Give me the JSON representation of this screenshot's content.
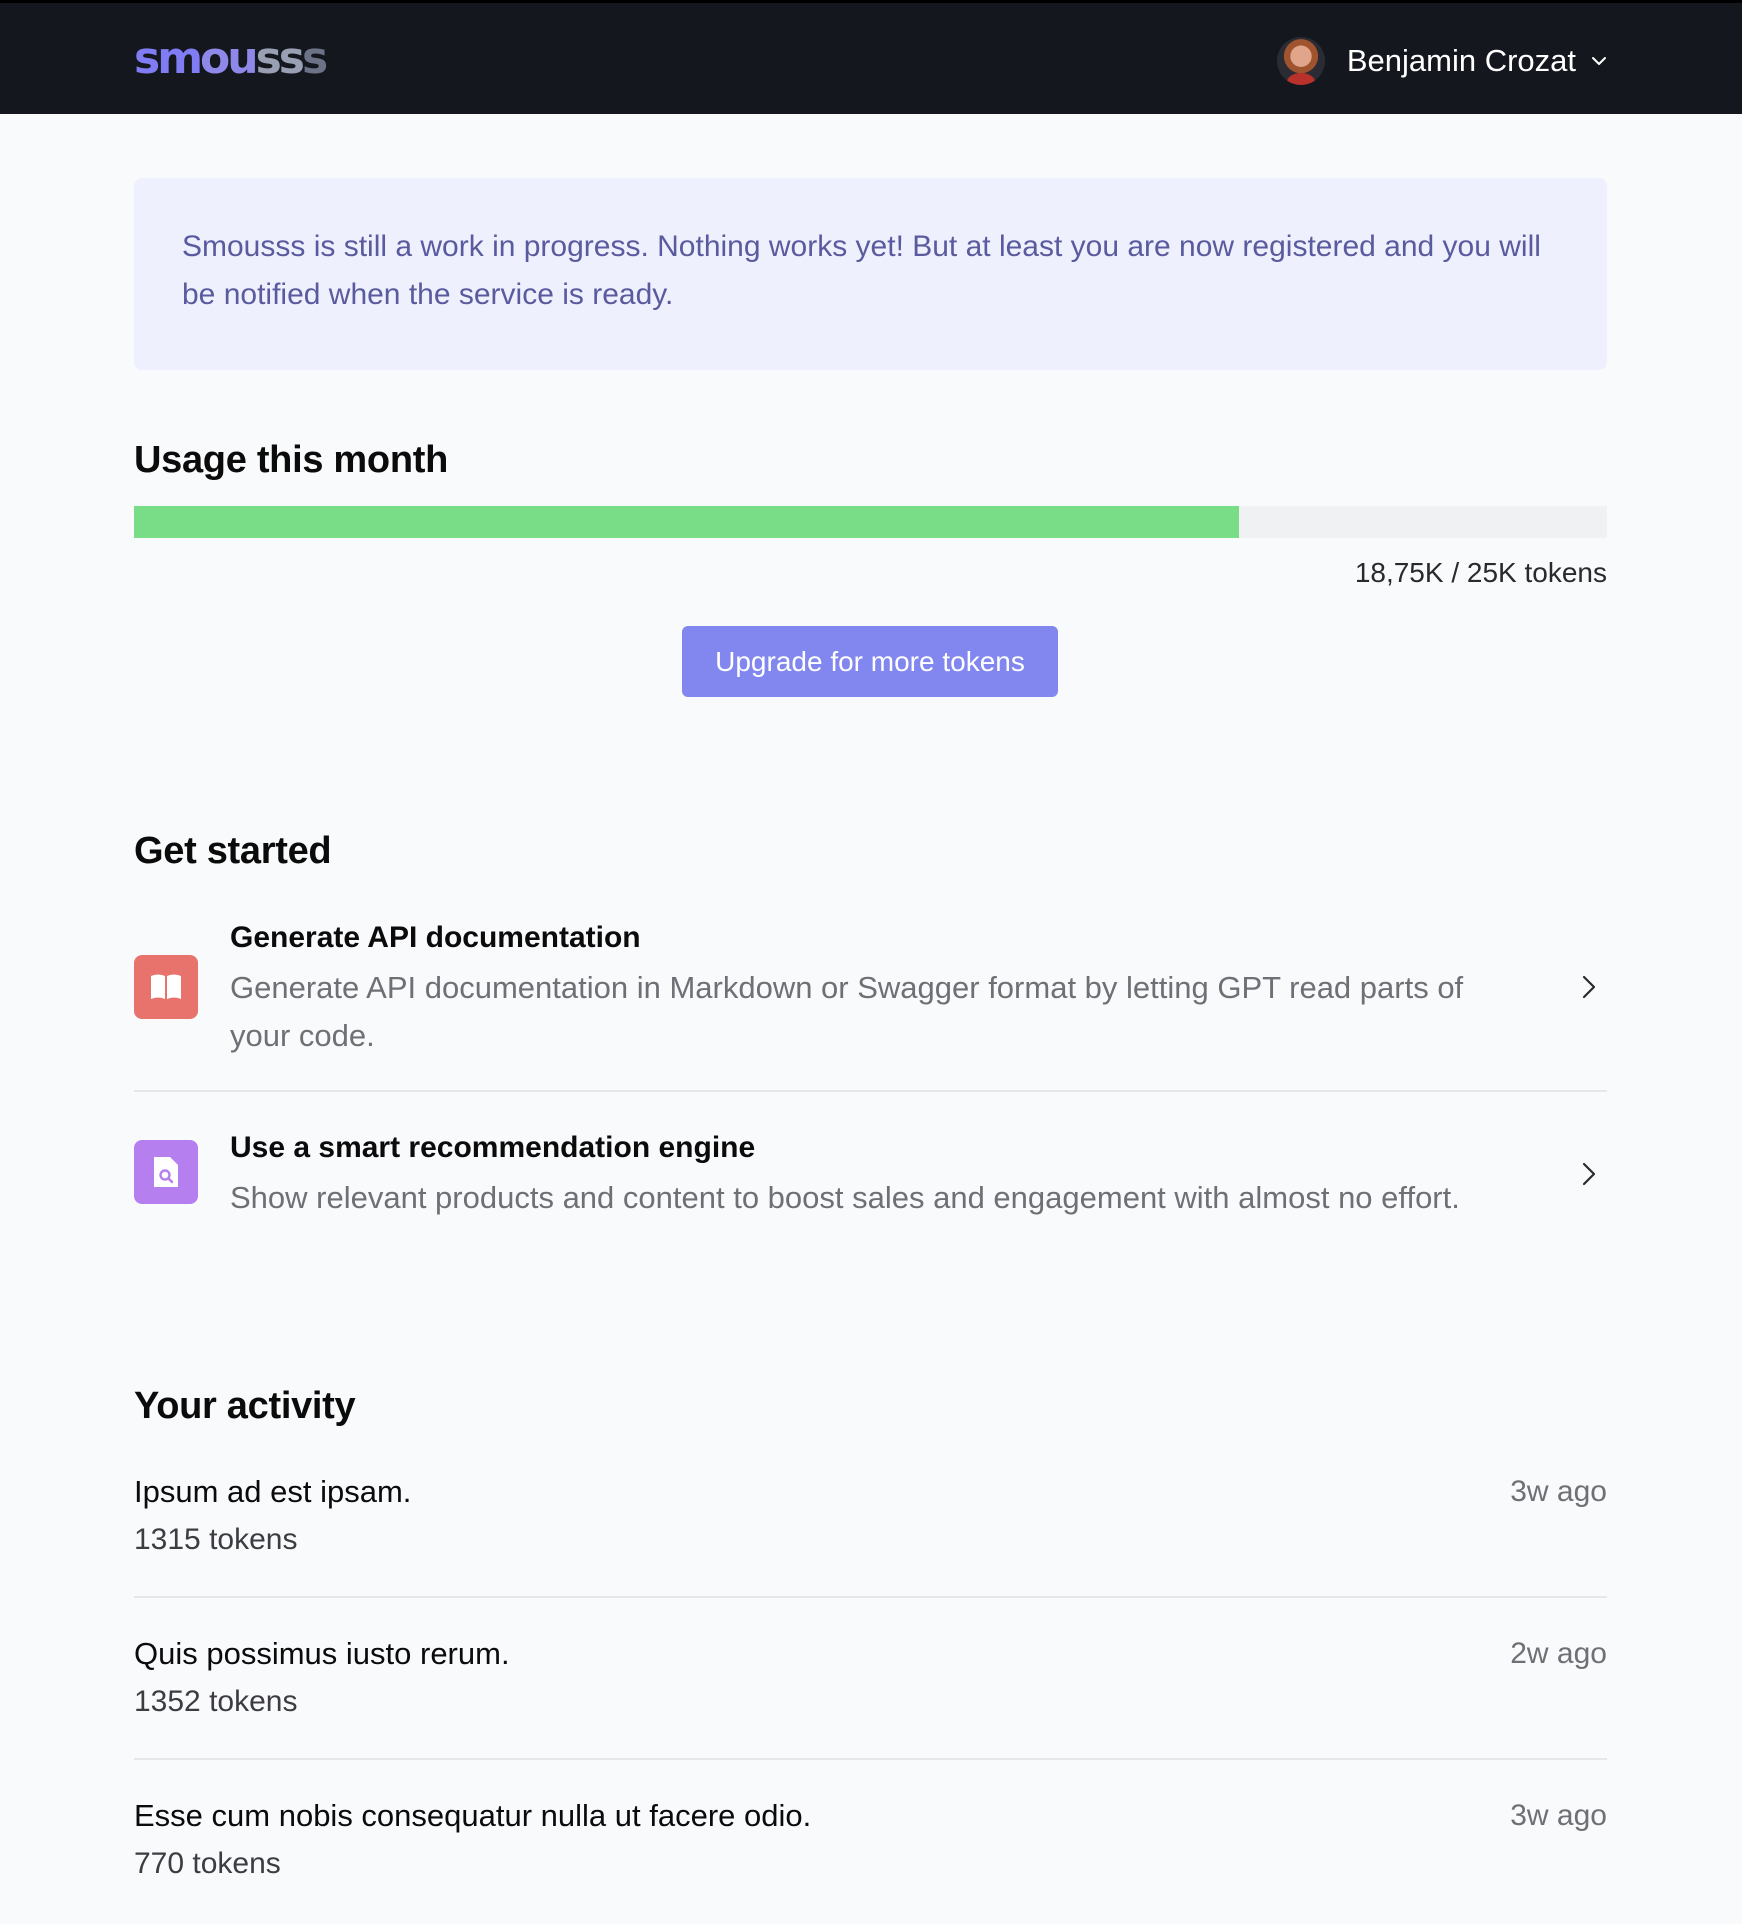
{
  "header": {
    "logo": [
      "sm",
      "ou",
      "ss",
      "s"
    ],
    "user_name": "Benjamin Crozat"
  },
  "notice": {
    "text": "Smousss is still a work in progress. Nothing works yet! But at least you are now registered and you will be notified when the service is ready."
  },
  "usage": {
    "heading": "Usage this month",
    "used_fraction": 0.75,
    "label": "18,75K / 25K tokens",
    "upgrade_label": "Upgrade for more tokens"
  },
  "get_started": {
    "heading": "Get started",
    "items": [
      {
        "title": "Generate API documentation",
        "description": "Generate API documentation in Markdown or Swagger format by letting GPT read parts of your code.",
        "icon": "book-icon",
        "icon_color": "#e8726c"
      },
      {
        "title": "Use a smart recommendation engine",
        "description": "Show relevant products and content to boost sales and engagement with almost no effort.",
        "icon": "document-search-icon",
        "icon_color": "#b57ff0"
      }
    ]
  },
  "activity": {
    "heading": "Your activity",
    "items": [
      {
        "title": "Ipsum ad est ipsam.",
        "tokens": "1315 tokens",
        "time": "3w ago"
      },
      {
        "title": "Quis possimus iusto rerum.",
        "tokens": "1352 tokens",
        "time": "2w ago"
      },
      {
        "title": "Esse cum nobis consequatur nulla ut facere odio.",
        "tokens": "770 tokens",
        "time": "3w ago"
      }
    ]
  },
  "colors": {
    "header_bg": "#15171f",
    "accent": "#8187ee",
    "progress": "#79dc86",
    "notice_bg": "#eef0fd"
  }
}
